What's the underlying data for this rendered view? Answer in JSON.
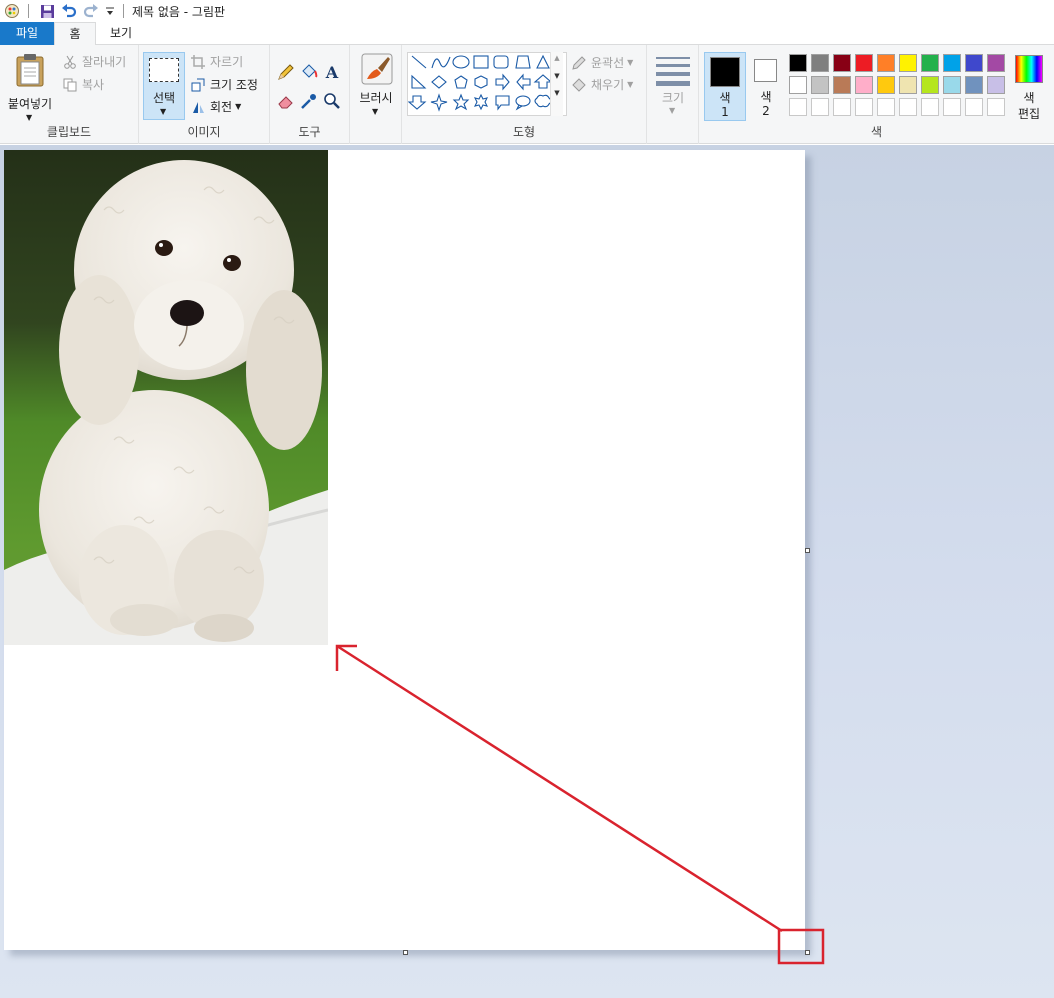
{
  "window": {
    "title": "제목 없음 - 그림판"
  },
  "quick_access": {
    "customize_label": "▾"
  },
  "tabs": {
    "file": "파일",
    "home": "홈",
    "view": "보기"
  },
  "clipboard": {
    "paste": "붙여넣기",
    "cut": "잘라내기",
    "copy": "복사",
    "group": "클립보드"
  },
  "image": {
    "select": "선택",
    "crop": "자르기",
    "resize": "크기 조정",
    "rotate": "회전",
    "group": "이미지"
  },
  "tools": {
    "group": "도구"
  },
  "brush": {
    "label": "브러시"
  },
  "shapes": {
    "outline": "윤곽선",
    "fill": "채우기",
    "group": "도형"
  },
  "size": {
    "label": "크기"
  },
  "colors": {
    "color1_label": "색",
    "color1_num": "1",
    "color2_label": "색",
    "color2_num": "2",
    "edit_label_1": "색",
    "edit_label_2": "편집",
    "group": "색",
    "color1_value": "#000000",
    "color2_value": "#ffffff",
    "palette_row1": [
      "#000000",
      "#7f7f7f",
      "#880015",
      "#ed1c24",
      "#ff7f27",
      "#fff200",
      "#22b14c",
      "#00a2e8",
      "#3f48cc",
      "#a349a4"
    ],
    "palette_row2": [
      "#ffffff",
      "#c3c3c3",
      "#b97a57",
      "#ffaec9",
      "#ffc90e",
      "#efe4b0",
      "#b5e61d",
      "#99d9ea",
      "#7092be",
      "#c8bfe7"
    ]
  },
  "annotation": {
    "color": "#d9232e"
  }
}
